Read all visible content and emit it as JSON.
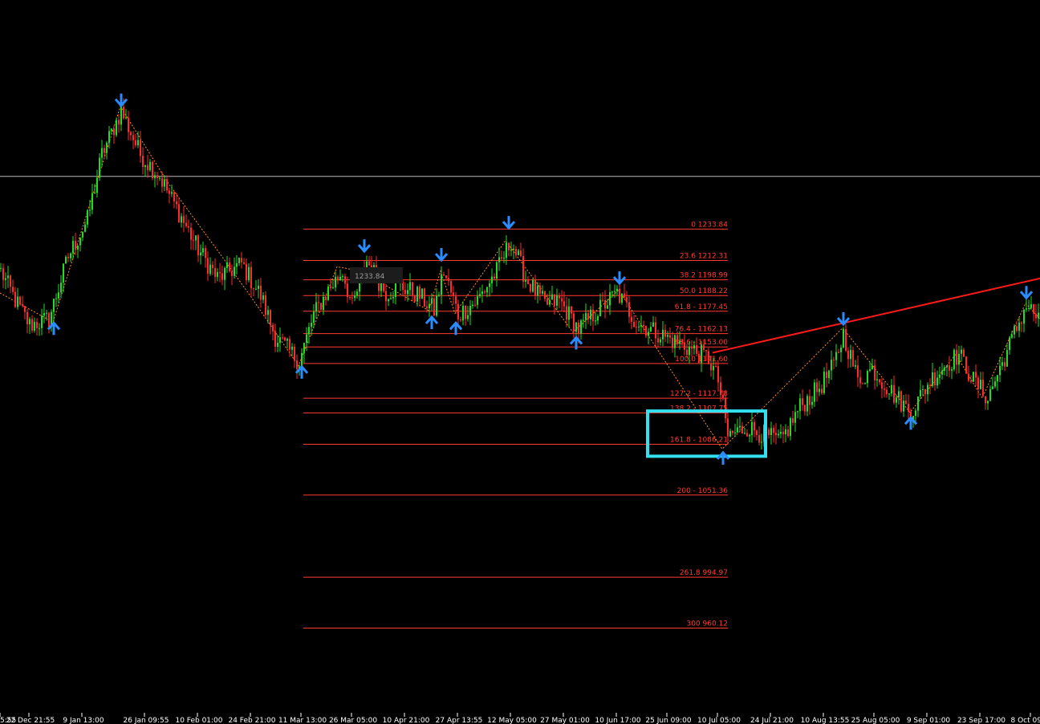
{
  "chart_data": {
    "type": "candlestick",
    "grid": false,
    "background": "#000000",
    "colors": {
      "bull": "#22dd22",
      "bear": "#ff2a2a",
      "fib_line": "#ff3b2f",
      "fib_label": "#ff3b2f",
      "trendline": "#ff1a1a",
      "zigzag": "#ff8c1a",
      "arrow": "#2a8cff",
      "highlight_box": "#33e0f0",
      "hline": "#b8b8b8",
      "axis_text": "#ffffff"
    },
    "y_range": [
      902,
      1391
    ],
    "x_ticks": [
      {
        "i": 0,
        "label": "5:55"
      },
      {
        "i": 12,
        "label": "22 Dec 21:55"
      },
      {
        "i": 34,
        "label": "9 Jan 13:00"
      },
      {
        "i": 60,
        "label": "26 Jan 09:55"
      },
      {
        "i": 82,
        "label": "10 Feb 01:00"
      },
      {
        "i": 104,
        "label": "24 Feb 21:00"
      },
      {
        "i": 125,
        "label": "11 Mar 13:00"
      },
      {
        "i": 146,
        "label": "26 Mar 05:00"
      },
      {
        "i": 168,
        "label": "10 Apr 21:00"
      },
      {
        "i": 190,
        "label": "27 Apr 13:55"
      },
      {
        "i": 212,
        "label": "12 May 05:00"
      },
      {
        "i": 234,
        "label": "27 May 01:00"
      },
      {
        "i": 256,
        "label": "10 Jun 17:00"
      },
      {
        "i": 277,
        "label": "25 Jun 09:00"
      },
      {
        "i": 298,
        "label": "10 Jul 05:00"
      },
      {
        "i": 320,
        "label": "24 Jul 21:00"
      },
      {
        "i": 342,
        "label": "10 Aug 13:55"
      },
      {
        "i": 363,
        "label": "25 Aug 05:00"
      },
      {
        "i": 385,
        "label": "9 Sep 01:00"
      },
      {
        "i": 407,
        "label": "23 Sep 17:00"
      },
      {
        "i": 428,
        "label": "8 Oct 09:00"
      }
    ],
    "horizontal_line": 1270,
    "fibonacci": [
      {
        "label": "0 1233.84",
        "price": 1233.84
      },
      {
        "label": "23.6 1212.31",
        "price": 1212.31
      },
      {
        "label": "38.2 1198.99",
        "price": 1198.99
      },
      {
        "label": "50.0 1188.22",
        "price": 1188.22
      },
      {
        "label": "61.8 - 1177.45",
        "price": 1177.45
      },
      {
        "label": "76.4 - 1162.13",
        "price": 1162.13
      },
      {
        "label": "88.6 - 1153.00",
        "price": 1153.0
      },
      {
        "label": "100.0 1141.60",
        "price": 1141.6
      },
      {
        "label": "127.2 - 1117.78",
        "price": 1117.78
      },
      {
        "label": "138.2 - 1107.75",
        "price": 1107.75
      },
      {
        "label": "161.8 -  1086.21",
        "price": 1086.21
      },
      {
        "label": "200 - 1051.36",
        "price": 1051.36
      },
      {
        "label": "261.8 994.97",
        "price": 994.97
      },
      {
        "label": "300 960.12",
        "price": 960.12
      }
    ],
    "fib_range_index": [
      126,
      301
    ],
    "trendline": [
      {
        "i": 296,
        "price": 1149
      },
      {
        "i": 432,
        "price": 1200
      }
    ],
    "highlight_box": {
      "i0": 268,
      "i1": 317,
      "p_top": 1109,
      "p_bottom": 1078
    },
    "ghost_label": "1233.84",
    "zigzag": [
      {
        "i": 0,
        "p": 1190
      },
      {
        "i": 22,
        "p": 1170
      },
      {
        "i": 50,
        "p": 1318
      },
      {
        "i": 70,
        "p": 1265
      },
      {
        "i": 90,
        "p": 1220
      },
      {
        "i": 104,
        "p": 1188
      },
      {
        "i": 124,
        "p": 1140
      },
      {
        "i": 140,
        "p": 1208
      },
      {
        "i": 150,
        "p": 1205
      },
      {
        "i": 178,
        "p": 1178
      },
      {
        "i": 183,
        "p": 1205
      },
      {
        "i": 189,
        "p": 1176
      },
      {
        "i": 210,
        "p": 1226
      },
      {
        "i": 238,
        "p": 1163
      },
      {
        "i": 257,
        "p": 1192
      },
      {
        "i": 300,
        "p": 1083
      },
      {
        "i": 350,
        "p": 1166
      },
      {
        "i": 378,
        "p": 1108
      },
      {
        "i": 397,
        "p": 1148
      },
      {
        "i": 408,
        "p": 1118
      },
      {
        "i": 426,
        "p": 1183
      },
      {
        "i": 432,
        "p": 1172
      }
    ],
    "arrows": [
      {
        "i": 22,
        "dir": "up",
        "p": 1170
      },
      {
        "i": 50,
        "dir": "down",
        "p": 1318
      },
      {
        "i": 125,
        "dir": "up",
        "p": 1140
      },
      {
        "i": 151,
        "dir": "down",
        "p": 1218
      },
      {
        "i": 179,
        "dir": "up",
        "p": 1174
      },
      {
        "i": 183,
        "dir": "down",
        "p": 1212
      },
      {
        "i": 189,
        "dir": "up",
        "p": 1170
      },
      {
        "i": 211,
        "dir": "down",
        "p": 1234
      },
      {
        "i": 239,
        "dir": "up",
        "p": 1160
      },
      {
        "i": 257,
        "dir": "down",
        "p": 1196
      },
      {
        "i": 300,
        "dir": "up",
        "p": 1081
      },
      {
        "i": 350,
        "dir": "down",
        "p": 1168
      },
      {
        "i": 378,
        "dir": "up",
        "p": 1105
      },
      {
        "i": 426,
        "dir": "down",
        "p": 1186
      }
    ],
    "anchor_series": [
      {
        "i": 0,
        "p": 1205
      },
      {
        "i": 6,
        "p": 1185
      },
      {
        "i": 12,
        "p": 1168
      },
      {
        "i": 20,
        "p": 1172
      },
      {
        "i": 28,
        "p": 1215
      },
      {
        "i": 36,
        "p": 1240
      },
      {
        "i": 42,
        "p": 1285
      },
      {
        "i": 50,
        "p": 1315
      },
      {
        "i": 58,
        "p": 1285
      },
      {
        "i": 66,
        "p": 1270
      },
      {
        "i": 74,
        "p": 1245
      },
      {
        "i": 82,
        "p": 1220
      },
      {
        "i": 90,
        "p": 1200
      },
      {
        "i": 100,
        "p": 1210
      },
      {
        "i": 108,
        "p": 1188
      },
      {
        "i": 114,
        "p": 1160
      },
      {
        "i": 124,
        "p": 1143
      },
      {
        "i": 130,
        "p": 1175
      },
      {
        "i": 136,
        "p": 1192
      },
      {
        "i": 142,
        "p": 1205
      },
      {
        "i": 146,
        "p": 1180
      },
      {
        "i": 152,
        "p": 1212
      },
      {
        "i": 160,
        "p": 1190
      },
      {
        "i": 166,
        "p": 1195
      },
      {
        "i": 174,
        "p": 1188
      },
      {
        "i": 180,
        "p": 1178
      },
      {
        "i": 184,
        "p": 1205
      },
      {
        "i": 190,
        "p": 1175
      },
      {
        "i": 198,
        "p": 1185
      },
      {
        "i": 206,
        "p": 1205
      },
      {
        "i": 212,
        "p": 1226
      },
      {
        "i": 218,
        "p": 1200
      },
      {
        "i": 226,
        "p": 1182
      },
      {
        "i": 232,
        "p": 1185
      },
      {
        "i": 240,
        "p": 1165
      },
      {
        "i": 248,
        "p": 1178
      },
      {
        "i": 256,
        "p": 1190
      },
      {
        "i": 264,
        "p": 1170
      },
      {
        "i": 276,
        "p": 1160
      },
      {
        "i": 286,
        "p": 1152
      },
      {
        "i": 294,
        "p": 1145
      },
      {
        "i": 298,
        "p": 1130
      },
      {
        "i": 302,
        "p": 1092
      },
      {
        "i": 310,
        "p": 1098
      },
      {
        "i": 318,
        "p": 1092
      },
      {
        "i": 324,
        "p": 1088
      },
      {
        "i": 332,
        "p": 1112
      },
      {
        "i": 340,
        "p": 1125
      },
      {
        "i": 346,
        "p": 1140
      },
      {
        "i": 350,
        "p": 1162
      },
      {
        "i": 356,
        "p": 1130
      },
      {
        "i": 362,
        "p": 1138
      },
      {
        "i": 370,
        "p": 1122
      },
      {
        "i": 378,
        "p": 1108
      },
      {
        "i": 386,
        "p": 1130
      },
      {
        "i": 392,
        "p": 1140
      },
      {
        "i": 398,
        "p": 1148
      },
      {
        "i": 404,
        "p": 1130
      },
      {
        "i": 410,
        "p": 1118
      },
      {
        "i": 418,
        "p": 1150
      },
      {
        "i": 426,
        "p": 1182
      },
      {
        "i": 432,
        "p": 1170
      }
    ]
  }
}
